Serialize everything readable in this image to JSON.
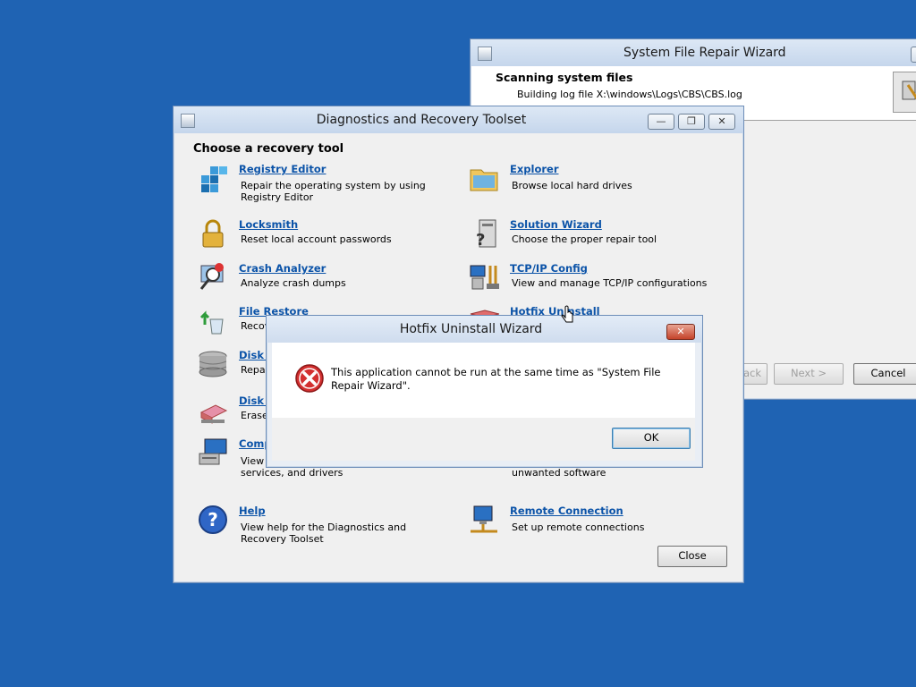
{
  "sfr": {
    "title": "System File Repair Wizard",
    "heading": "Scanning system files",
    "status": "Building log file X:\\windows\\Logs\\CBS\\CBS.log",
    "back_label": "Back",
    "next_label": "Next >",
    "cancel_label": "Cancel"
  },
  "dart": {
    "title": "Diagnostics and Recovery Toolset",
    "heading": "Choose a recovery tool",
    "close_label": "Close",
    "tools": [
      {
        "name": "Registry Editor",
        "desc": "Repair the operating system by using Registry Editor",
        "icon": "registry-editor-icon"
      },
      {
        "name": "Explorer",
        "desc": "Browse local hard drives",
        "icon": "explorer-icon"
      },
      {
        "name": "Locksmith",
        "desc": "Reset local account passwords",
        "icon": "lock-icon"
      },
      {
        "name": "Solution Wizard",
        "desc": "Choose the proper repair tool",
        "icon": "solution-wizard-icon"
      },
      {
        "name": "Crash Analyzer",
        "desc": "Analyze crash dumps",
        "icon": "crash-analyzer-icon"
      },
      {
        "name": "TCP/IP Config",
        "desc": "View and manage TCP/IP configurations",
        "icon": "network-config-icon"
      },
      {
        "name": "File Restore",
        "desc": "Recov",
        "icon": "file-restore-icon"
      },
      {
        "name": "Hotfix Uninstall",
        "desc": "",
        "icon": "hotfix-uninstall-icon"
      },
      {
        "name": "Disk C",
        "desc": "Repai",
        "icon": "disk-icon"
      },
      {
        "name": "Disk W",
        "desc": "Erase",
        "icon": "disk-wipe-icon"
      },
      {
        "name": "Comp",
        "desc": "View a autorun, events, storage, services, and drivers",
        "icon": "computer-management-icon"
      },
      {
        "name": "",
        "desc": "unwanted software",
        "icon": ""
      },
      {
        "name": "Help",
        "desc": "View help for the Diagnostics and Recovery Toolset",
        "icon": "help-icon"
      },
      {
        "name": "Remote Connection",
        "desc": "Set up remote connections",
        "icon": "remote-connection-icon"
      }
    ]
  },
  "hotfix": {
    "title": "Hotfix Uninstall Wizard",
    "message": "This application cannot be run at the same time as \"System File Repair Wizard\".",
    "ok_label": "OK"
  },
  "colors": {
    "desktop": "#1f63b3",
    "link": "#0b53a8",
    "error": "#d32f2f"
  }
}
